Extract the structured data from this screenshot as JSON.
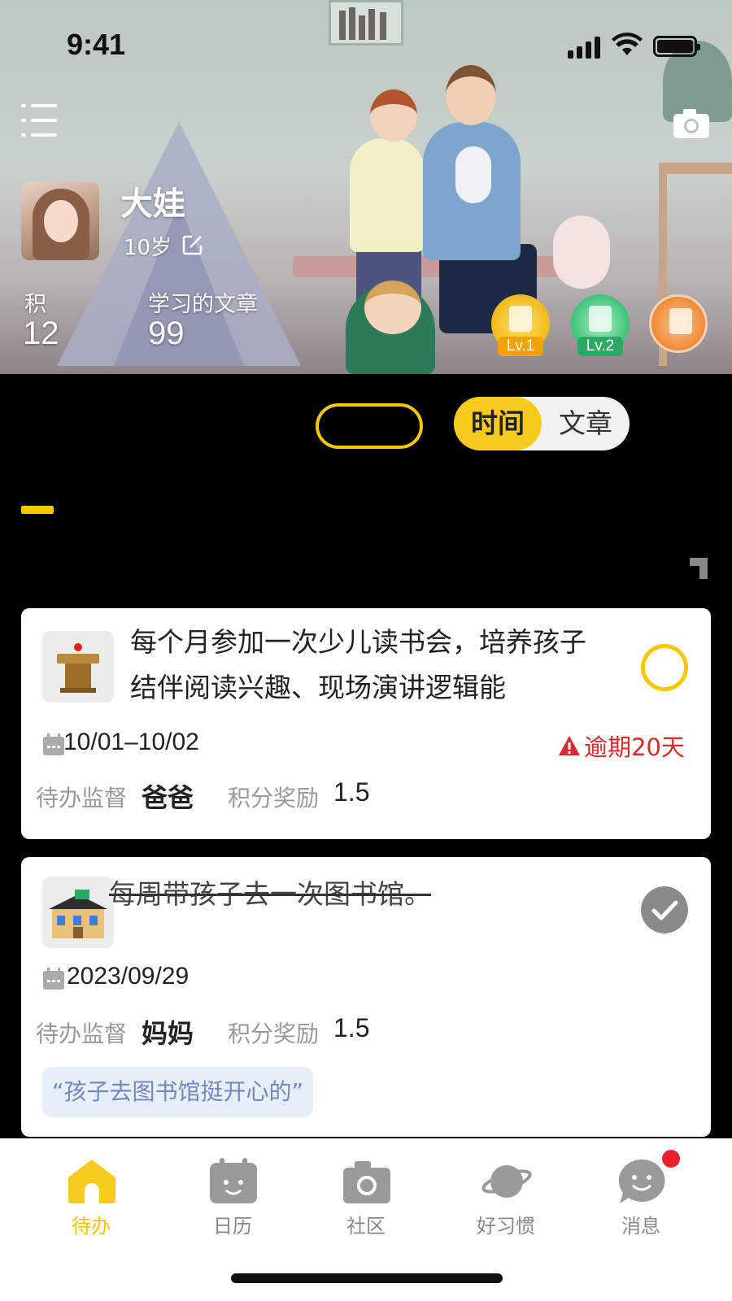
{
  "status_bar": {
    "time": "9:41"
  },
  "profile": {
    "name": "大娃",
    "age": "10岁",
    "stats": [
      {
        "label": "积",
        "value": "12"
      },
      {
        "label": "学习的文章",
        "value": "99"
      }
    ],
    "badges": [
      {
        "level": "Lv.1",
        "color": "#f2b81c"
      },
      {
        "level": "Lv.2",
        "color": "#3fc27a"
      },
      {
        "level": "",
        "color": "#f08a3a"
      }
    ]
  },
  "sort_toggle": {
    "options": [
      "时间",
      "文章"
    ],
    "selected": "时间"
  },
  "tasks": [
    {
      "title": "每个月参加一次少儿读书会，培养孩子结伴阅读兴趣、现场演讲逻辑能",
      "date": "10/01–10/02",
      "overdue": "逾期20天",
      "supervisor_label": "待办监督",
      "supervisor": "爸爸",
      "points_label": "积分奖励",
      "points": "1.5",
      "completed": false,
      "icon": "podium-icon"
    },
    {
      "title": "每周带孩子去一次图书馆。",
      "date": "2023/09/29",
      "supervisor_label": "待办监督",
      "supervisor": "妈妈",
      "points_label": "积分奖励",
      "points": "1.5",
      "comment": "“孩子去图书馆挺开心的”",
      "completed": true,
      "icon": "library-icon"
    }
  ],
  "tabbar": {
    "items": [
      {
        "label": "待办",
        "icon": "home-icon",
        "active": true
      },
      {
        "label": "日历",
        "icon": "calendar-icon",
        "active": false
      },
      {
        "label": "社区",
        "icon": "camera-icon",
        "active": false
      },
      {
        "label": "好习惯",
        "icon": "planet-icon",
        "active": false
      },
      {
        "label": "消息",
        "icon": "chat-icon",
        "active": false,
        "has_notification": true
      }
    ]
  },
  "colors": {
    "accent": "#f7cb1b",
    "overdue": "#d72b2b",
    "comment_bg": "#e6eef8",
    "comment_text": "#7387bd"
  }
}
